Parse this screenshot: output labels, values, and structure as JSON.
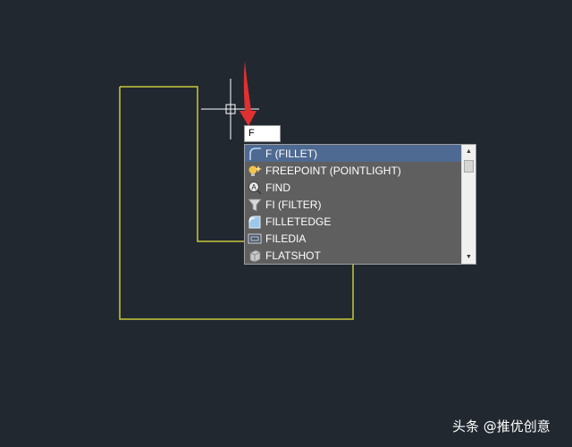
{
  "command_line": {
    "typed_text": "F"
  },
  "autocomplete": {
    "items": [
      {
        "label": "F (FILLET)",
        "icon": "fillet-icon",
        "selected": true
      },
      {
        "label": "FREEPOINT (POINTLIGHT)",
        "icon": "pointlight-icon",
        "selected": false
      },
      {
        "label": "FIND",
        "icon": "find-icon",
        "selected": false
      },
      {
        "label": "FI (FILTER)",
        "icon": "filter-icon",
        "selected": false
      },
      {
        "label": "FILLETEDGE",
        "icon": "filletedge-icon",
        "selected": false
      },
      {
        "label": "FILEDIA",
        "icon": "filedia-icon",
        "selected": false
      },
      {
        "label": "FLATSHOT",
        "icon": "flatshot-icon",
        "selected": false
      }
    ],
    "scroll_up_glyph": "▲",
    "scroll_down_glyph": "▼"
  },
  "watermark": {
    "text": "头条 @推优创意"
  },
  "colors": {
    "canvas_background": "#212830",
    "geometry_line": "#c8c83a",
    "crosshair": "#ffffff",
    "pointer_arrow": "#e03030",
    "list_background": "#5f5f5f",
    "selection": "#4e6a92"
  }
}
